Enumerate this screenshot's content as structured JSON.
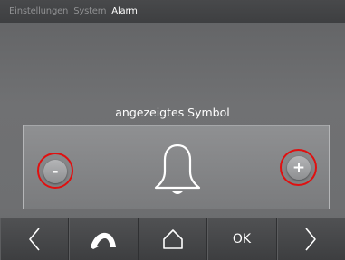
{
  "breadcrumb": {
    "items": [
      "Einstellungen",
      "System",
      "Alarm"
    ]
  },
  "section": {
    "title": "angezeigtes Symbol"
  },
  "symbol_selector": {
    "decrement_label": "-",
    "increment_label": "+",
    "current_symbol": "bell-icon",
    "highlight_color": "#e01010"
  },
  "navbar": {
    "ok_label": "OK",
    "icons": [
      "arrow-left-icon",
      "back-icon",
      "home-icon",
      "ok",
      "arrow-right-icon"
    ]
  }
}
